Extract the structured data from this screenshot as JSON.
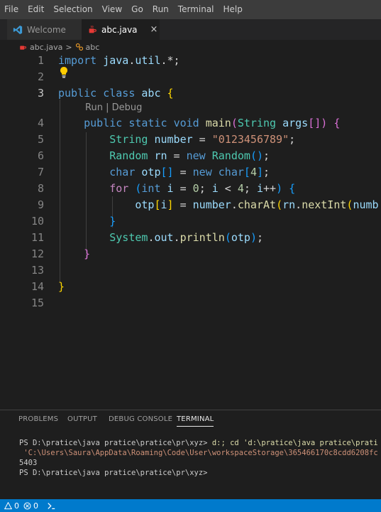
{
  "menu": [
    "File",
    "Edit",
    "Selection",
    "View",
    "Go",
    "Run",
    "Terminal",
    "Help"
  ],
  "tabs": {
    "welcome": {
      "label": "Welcome",
      "icon": "vscode-icon"
    },
    "abc": {
      "label": "abc.java",
      "icon": "java-file-icon",
      "close": "×"
    }
  },
  "breadcrumb": {
    "file": "abc.java",
    "sep": ">",
    "symbol": "abc"
  },
  "editor": {
    "line_numbers": [
      "1",
      "2",
      "3",
      "4",
      "5",
      "6",
      "7",
      "8",
      "9",
      "10",
      "11",
      "12",
      "13",
      "14",
      "15"
    ],
    "codelens": {
      "run": "Run",
      "sep": " | ",
      "debug": "Debug"
    },
    "lines": [
      "import java.util.*;",
      "",
      "public class abc {",
      "    public static void main(String args[]) {",
      "        String number = \"0123456789\";",
      "        Random rn = new Random();",
      "        char otp[] = new char[4];",
      "        for (int i = 0; i < 4; i++) {",
      "            otp[i] = number.charAt(rn.nextInt(numb",
      "        }",
      "        System.out.println(otp);",
      "    }",
      "",
      "}",
      ""
    ]
  },
  "panel": {
    "tabs": [
      "PROBLEMS",
      "OUTPUT",
      "DEBUG CONSOLE",
      "TERMINAL"
    ],
    "active_tab": "TERMINAL",
    "terminal": {
      "line1_prompt": "PS D:\\pratice\\java pratice\\pratice\\pr\\xyz> ",
      "line1_cmd": "d:; cd 'd:\\pratice\\java pratice\\prati",
      "line2": " 'C:\\Users\\Saura\\AppData\\Roaming\\Code\\User\\workspaceStorage\\365466170c8cdd6208fc",
      "line3": "5403",
      "line4": "PS D:\\pratice\\java pratice\\pratice\\pr\\xyz>"
    }
  },
  "statusbar": {
    "warnings": "0",
    "errors": "0"
  },
  "colors": {
    "accent": "#007acc",
    "editor_bg": "#1e1e1e",
    "keyword": "#569cd6",
    "string": "#ce9178"
  }
}
